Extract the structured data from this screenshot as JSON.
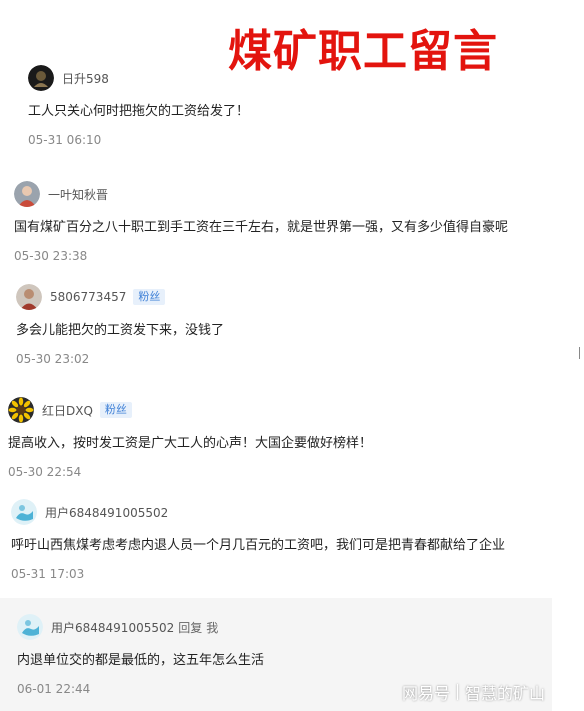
{
  "banner": "煤矿职工留言",
  "comments": [
    {
      "user": "日升598",
      "text": "工人只关心何时把拖欠的工资给发了！",
      "time": "05-31 06:10",
      "avatar": "dark-round-avatar"
    },
    {
      "user": "一叶知秋晋",
      "text": "国有煤矿百分之八十职工到手工资在三千左右，就是世界第一强，又有多少值得自豪呢",
      "time": "05-30 23:38",
      "avatar": "photo-avatar"
    },
    {
      "user": "5806773457",
      "badge": "粉丝",
      "text": "多会儿能把欠的工资发下来，没钱了",
      "time": "05-30 23:02",
      "avatar": "photo-avatar"
    },
    {
      "user": "红日DXQ",
      "badge": "粉丝",
      "text": "提高收入，按时发工资是广大工人的心声！大国企要做好榜样！",
      "time": "05-30 22:54",
      "avatar": "sunflower-avatar"
    },
    {
      "user": "用户6848491005502",
      "text": "呼吁山西焦煤考虑考虑内退人员一个月几百元的工资吧，我们可是把青春都献给了企业",
      "time": "05-31 17:03",
      "avatar": "default-avatar"
    }
  ],
  "reply": {
    "user": "用户6848491005502",
    "reply_label": "回复",
    "reply_to": "我",
    "text": "内退单位交的都是最低的，这五年怎么生活",
    "time": "06-01 22:44",
    "avatar": "default-avatar"
  },
  "watermark": {
    "brand": "网易号",
    "channel": "智慧的矿山"
  },
  "colors": {
    "banner": "#e3140e",
    "badge_text": "#3d7fd6",
    "badge_bg": "#e7f0fb",
    "reply_bg": "#f5f5f5"
  }
}
